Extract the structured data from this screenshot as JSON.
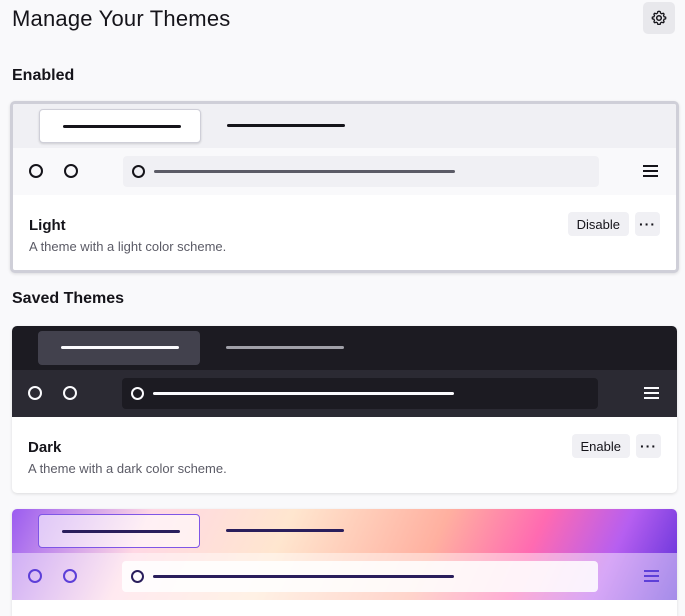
{
  "header": {
    "title": "Manage Your Themes",
    "settings_icon": "gear-icon"
  },
  "sections": {
    "enabled": "Enabled",
    "saved": "Saved Themes"
  },
  "themes": {
    "light": {
      "name": "Light",
      "description": "A theme with a light color scheme.",
      "action": "Disable",
      "more": "···"
    },
    "dark": {
      "name": "Dark",
      "description": "A theme with a dark color scheme.",
      "action": "Enable",
      "more": "···"
    }
  },
  "colors": {
    "page_bg": "#f9f9fb",
    "light_tabstrip": "#f0f0f4",
    "dark_tabstrip": "#1c1b22",
    "dark_toolbar": "#2b2a33",
    "alpenglow_accent": "#5d3fd8"
  }
}
